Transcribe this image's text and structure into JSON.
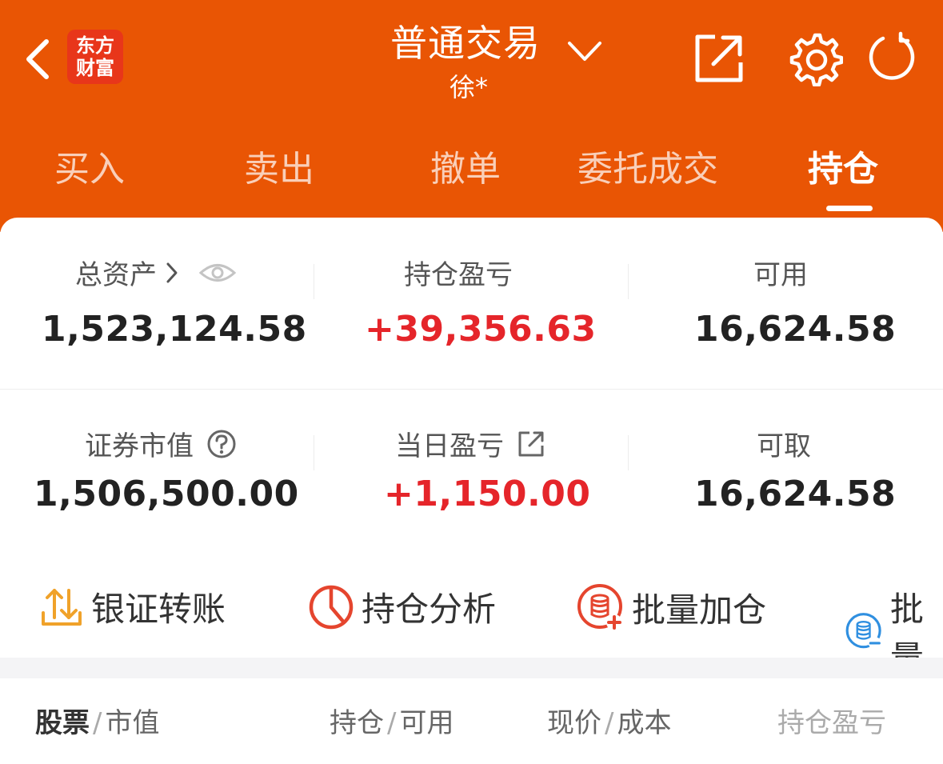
{
  "header": {
    "logo_line1": "东方",
    "logo_line2": "财富",
    "title": "普通交易",
    "subtitle": "徐*",
    "icons": [
      "back-arrow-icon",
      "chevron-down-icon",
      "share-icon",
      "gear-icon",
      "refresh-icon"
    ],
    "background_color": "#E95504"
  },
  "tabs": [
    {
      "label": "买入",
      "active": false
    },
    {
      "label": "卖出",
      "active": false
    },
    {
      "label": "撤单",
      "active": false
    },
    {
      "label": "委托成交",
      "active": false
    },
    {
      "label": "持仓",
      "active": true
    }
  ],
  "summary": {
    "total_assets": {
      "label": "总资产",
      "value": "1,523,124.58"
    },
    "position_pnl": {
      "label": "持仓盈亏",
      "value": "+39,356.63"
    },
    "available": {
      "label": "可用",
      "value": "16,624.58"
    },
    "market_value": {
      "label": "证券市值",
      "value": "1,506,500.00"
    },
    "daily_pnl": {
      "label": "当日盈亏",
      "value": "+1,150.00"
    },
    "withdrawable": {
      "label": "可取",
      "value": "16,624.58"
    },
    "positive_color": "#E5252A"
  },
  "tools": [
    {
      "label": "银证转账",
      "icon": "transfer-icon"
    },
    {
      "label": "持仓分析",
      "icon": "pie-chart-icon"
    },
    {
      "label": "批量加仓",
      "icon": "database-add-icon"
    },
    {
      "label": "批量",
      "icon": "database-minus-icon"
    }
  ],
  "table_header": {
    "col1_main": "股票",
    "col1_sub": "市值",
    "col2_main": "持仓",
    "col2_sub": "可用",
    "col3_main": "现价",
    "col3_sub": "成本",
    "col4": "持仓盈亏"
  }
}
